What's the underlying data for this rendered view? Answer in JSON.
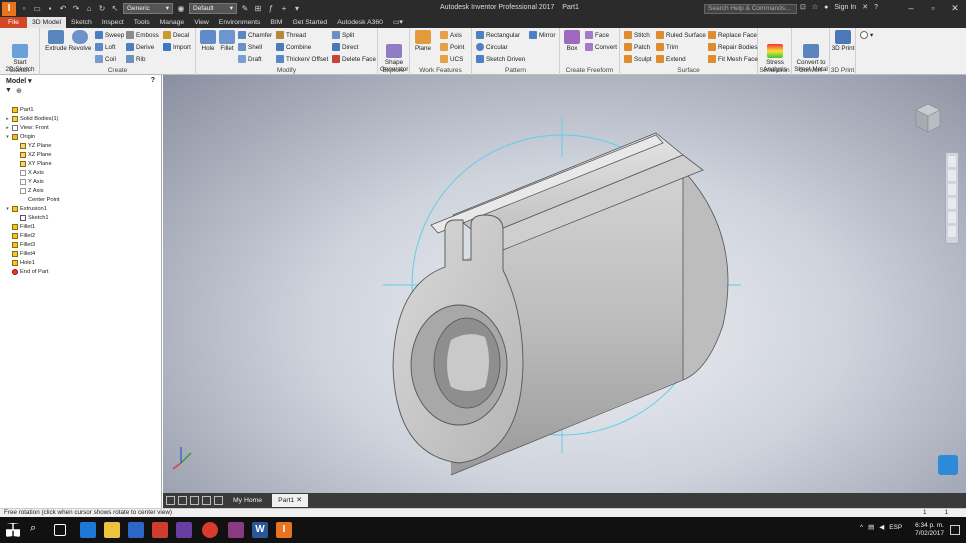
{
  "app": {
    "title": "Autodesk Inventor Professional 2017",
    "document": "Part1",
    "search_placeholder": "Search Help & Commands...",
    "sign_in": "Sign In"
  },
  "qat": {
    "material": "Generic",
    "appearance": "Default"
  },
  "tabs": [
    "File",
    "3D Model",
    "Sketch",
    "Inspect",
    "Tools",
    "Manage",
    "View",
    "Environments",
    "BIM",
    "Get Started",
    "Autodesk A360"
  ],
  "ribbon": {
    "sketch": {
      "label": "Sketch",
      "start": "Start\n2D Sketch"
    },
    "create": {
      "label": "Create",
      "extrude": "Extrude",
      "revolve": "Revolve",
      "sweep": "Sweep",
      "loft": "Loft",
      "coil": "Coil",
      "emboss": "Emboss",
      "derive": "Derive",
      "rib": "Rib",
      "decal": "Decal",
      "import": "Import"
    },
    "modify": {
      "label": "Modify",
      "hole": "Hole",
      "fillet": "Fillet",
      "chamfer": "Chamfer",
      "shell": "Shell",
      "draft": "Draft",
      "thread": "Thread",
      "combine": "Combine",
      "thicken": "Thicken/ Offset",
      "split": "Split",
      "direct": "Direct",
      "delete_face": "Delete Face"
    },
    "explore": {
      "label": "Explore",
      "shape_gen": "Shape\nGenerator"
    },
    "work_features": {
      "label": "Work Features",
      "plane": "Plane",
      "axis": "Axis",
      "point": "Point",
      "ucs": "UCS"
    },
    "pattern": {
      "label": "Pattern",
      "rectangular": "Rectangular",
      "circular": "Circular",
      "sketch_driven": "Sketch Driven",
      "mirror": "Mirror"
    },
    "freeform": {
      "label": "Create Freeform",
      "box": "Box",
      "face": "Face",
      "convert": "Convert"
    },
    "surface": {
      "label": "Surface",
      "stitch": "Stitch",
      "patch": "Patch",
      "sculpt": "Sculpt",
      "ruled": "Ruled Surface",
      "trim": "Trim",
      "extend": "Extend",
      "replace_face": "Replace Face",
      "repair_bodies": "Repair Bodies",
      "fit_mesh": "Fit Mesh Face"
    },
    "simulation": {
      "label": "Simulation",
      "stress": "Stress\nAnalysis"
    },
    "convert": {
      "label": "Convert",
      "sheet_metal": "Convert to\nSheet Metal"
    },
    "print3d": {
      "label": "3D Print",
      "btn": "3D Print"
    }
  },
  "browser": {
    "title": "Model",
    "nodes": [
      "Part1",
      "Solid Bodies(1)",
      "View: Front",
      "Origin",
      "YZ Plane",
      "XZ Plane",
      "XY Plane",
      "X Axis",
      "Y Axis",
      "Z Axis",
      "Center Point",
      "Extrusion1",
      "Sketch1",
      "Fillet1",
      "Fillet2",
      "Fillet3",
      "Fillet4",
      "Hole1",
      "End of Part"
    ]
  },
  "doc_tabs": [
    "My Home",
    "Part1"
  ],
  "status": {
    "text": "Free rotation (click when cursor shows rotate to center view)",
    "count1": "1",
    "count2": "1"
  },
  "taskbar": {
    "lang": "ESP",
    "time": "6:34 p. m.",
    "date": "7/02/2017"
  },
  "colors": {
    "file_tab": "#d24726",
    "accent": "#e8741e",
    "viewport_bg": "#cfd3dc",
    "sketch_circle": "#5ecfe6"
  }
}
